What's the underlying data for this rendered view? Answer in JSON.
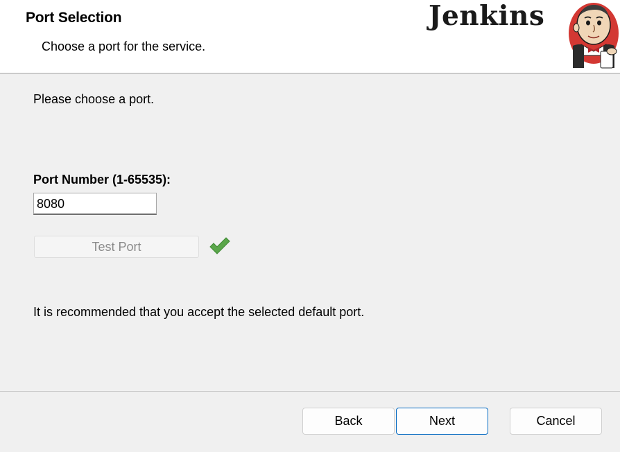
{
  "header": {
    "title": "Port Selection",
    "subtitle": "Choose a port for the service.",
    "logo_text": "Jenkins",
    "logo_icon": "jenkins-butler-icon"
  },
  "body": {
    "instruction": "Please choose a port.",
    "port_label": "Port Number (1-65535):",
    "port_value": "8080",
    "test_port_label": "Test Port",
    "test_port_enabled": false,
    "status_icon": "checkmark-icon",
    "status_color": "#5aa64a",
    "recommendation": "It is recommended that you accept the selected default port."
  },
  "footer": {
    "back_label": "Back",
    "next_label": "Next",
    "cancel_label": "Cancel",
    "default_button_color": "#0067c0"
  }
}
